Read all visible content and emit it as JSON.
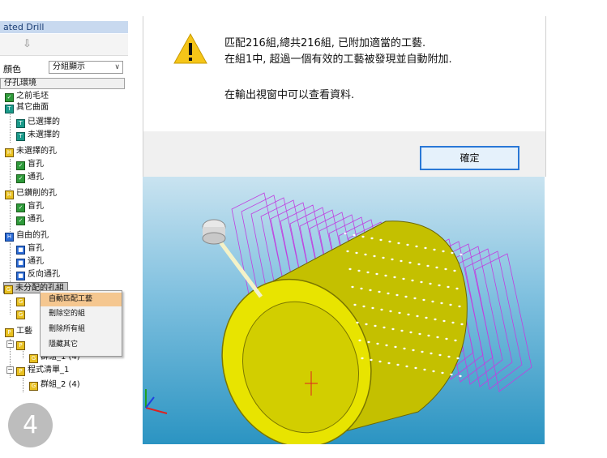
{
  "panel": {
    "title": "ated Drill",
    "color_label": "顏色",
    "display_mode": "分組顯示",
    "section_header": "仔孔環境",
    "tree": [
      {
        "label": "之前毛坯"
      },
      {
        "label": "其它曲面"
      },
      {
        "label": "已選擇的"
      },
      {
        "label": "未選擇的"
      },
      {
        "label": "未選擇的孔"
      },
      {
        "label": "盲孔"
      },
      {
        "label": "通孔"
      },
      {
        "label": "已鑽削的孔"
      },
      {
        "label": "盲孔"
      },
      {
        "label": "通孔"
      },
      {
        "label": "自由的孔"
      },
      {
        "label": "盲孔"
      },
      {
        "label": "通孔"
      },
      {
        "label": "反向通孔"
      },
      {
        "label": "未分配的孔組"
      },
      {
        "label": "工藝"
      },
      {
        "label": "群組_1 (4)"
      },
      {
        "label": "程式清單_1"
      },
      {
        "label": "群組_2 (4)"
      }
    ],
    "context_menu": [
      {
        "label": "自動匹配工藝"
      },
      {
        "label": "刪除空的組"
      },
      {
        "label": "刪除所有組"
      },
      {
        "label": "隱藏其它"
      }
    ]
  },
  "step_number": "4",
  "dialog": {
    "line1": "匹配216組,總共216組, 已附加適當的工藝.",
    "line2": "在組1中, 超過一個有效的工藝被發現並自動附加.",
    "line3": "在輸出視窗中可以查看資料.",
    "ok_label": "確定"
  },
  "colors": {
    "cylinder": "#d6d200",
    "lines": "#c040e0",
    "ok_border": "#2a78d6",
    "viewport_bottom": "#2b94c2"
  }
}
